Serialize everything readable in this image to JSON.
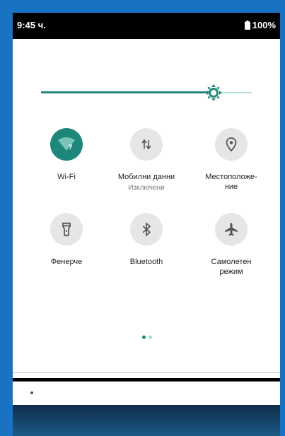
{
  "status_bar": {
    "time": "9:45 ч.",
    "battery": "100%"
  },
  "brightness": {
    "level": 0.82,
    "accent": "#22877c"
  },
  "tiles": [
    {
      "label": "Wi-Fi",
      "sublabel": "",
      "icon": "wifi-icon",
      "active": true
    },
    {
      "label": "Мобилни данни",
      "sublabel": "Изключени",
      "icon": "mobile-data-icon",
      "active": false
    },
    {
      "label": "Местоположе-",
      "label2": "ние",
      "sublabel": "",
      "icon": "location-icon",
      "active": false
    },
    {
      "label": "Фенерче",
      "sublabel": "",
      "icon": "flashlight-icon",
      "active": false
    },
    {
      "label": "Bluetooth",
      "sublabel": "",
      "icon": "bluetooth-icon",
      "active": false
    },
    {
      "label": "Самолетен",
      "label2": "режим",
      "sublabel": "",
      "icon": "airplane-icon",
      "active": false
    }
  ],
  "pager": {
    "current_page": 1,
    "total_pages": 2
  },
  "colors": {
    "accent": "#1e877b",
    "tile_off": "#e6e6e6",
    "icon_gray": "#555555"
  }
}
